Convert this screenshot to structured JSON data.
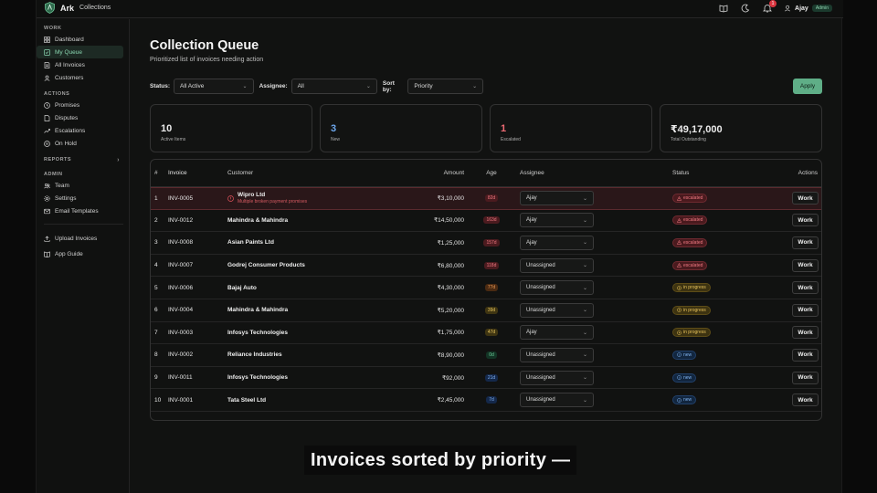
{
  "brand": {
    "name": "Ark",
    "sub": "Collections"
  },
  "topbar": {
    "notification_count": "1",
    "user_name": "Ajay",
    "user_role": "Admin"
  },
  "sidebar": {
    "work_title": "WORK",
    "work_items": [
      {
        "label": "Dashboard",
        "icon": "dashboard-icon"
      },
      {
        "label": "My Queue",
        "icon": "queue-icon",
        "active": true
      },
      {
        "label": "All Invoices",
        "icon": "invoices-icon"
      },
      {
        "label": "Customers",
        "icon": "customers-icon"
      }
    ],
    "actions_title": "ACTIONS",
    "actions_items": [
      {
        "label": "Promises",
        "icon": "clock-icon"
      },
      {
        "label": "Disputes",
        "icon": "file-icon"
      },
      {
        "label": "Escalations",
        "icon": "trend-icon"
      },
      {
        "label": "On Hold",
        "icon": "pause-icon"
      }
    ],
    "reports_title": "REPORTS",
    "admin_title": "ADMIN",
    "admin_items": [
      {
        "label": "Team",
        "icon": "team-icon"
      },
      {
        "label": "Settings",
        "icon": "gear-icon"
      },
      {
        "label": "Email Templates",
        "icon": "mail-icon"
      }
    ],
    "bottom_items": [
      {
        "label": "Upload Invoices",
        "icon": "upload-icon"
      },
      {
        "label": "App Guide",
        "icon": "book-icon"
      }
    ]
  },
  "page": {
    "title": "Collection Queue",
    "subtitle": "Prioritized list of invoices needing action"
  },
  "filters": {
    "status_label": "Status:",
    "status_value": "All Active",
    "assignee_label": "Assignee:",
    "assignee_value": "All",
    "sort_label": "Sort by:",
    "sort_value": "Priority",
    "apply_label": "Apply"
  },
  "cards": [
    {
      "value": "10",
      "label": "Active Items",
      "color": "#eaeaea"
    },
    {
      "value": "3",
      "label": "New",
      "color": "#6ea8ee"
    },
    {
      "value": "1",
      "label": "Escalated",
      "color": "#ef6b74"
    },
    {
      "value": "₹49,17,000",
      "label": "Total Outstanding",
      "color": "#eaeaea"
    }
  ],
  "table": {
    "headers": {
      "num": "#",
      "invoice": "Invoice",
      "customer": "Customer",
      "amount": "Amount",
      "age": "Age",
      "assignee": "Assignee",
      "status": "Status",
      "actions": "Actions"
    },
    "work_label": "Work",
    "rows": [
      {
        "num": "1",
        "invoice": "INV-0005",
        "customer": "Wipro Ltd",
        "note": "Multiple broken payment promises",
        "amount": "₹3,10,000",
        "age": "82d",
        "age_style": "red",
        "assignee": "Ajay",
        "status": "escalated"
      },
      {
        "num": "2",
        "invoice": "INV-0012",
        "customer": "Mahindra & Mahindra",
        "note": "",
        "amount": "₹14,50,000",
        "age": "163d",
        "age_style": "red",
        "assignee": "Ajay",
        "status": "escalated"
      },
      {
        "num": "3",
        "invoice": "INV-0008",
        "customer": "Asian Paints Ltd",
        "note": "",
        "amount": "₹1,25,000",
        "age": "157d",
        "age_style": "red",
        "assignee": "Ajay",
        "status": "escalated"
      },
      {
        "num": "4",
        "invoice": "INV-0007",
        "customer": "Godrej Consumer Products",
        "note": "",
        "amount": "₹6,80,000",
        "age": "118d",
        "age_style": "red",
        "assignee": "Unassigned",
        "status": "escalated"
      },
      {
        "num": "5",
        "invoice": "INV-0006",
        "customer": "Bajaj Auto",
        "note": "",
        "amount": "₹4,30,000",
        "age": "77d",
        "age_style": "orange",
        "assignee": "Unassigned",
        "status": "in progress"
      },
      {
        "num": "6",
        "invoice": "INV-0004",
        "customer": "Mahindra & Mahindra",
        "note": "",
        "amount": "₹5,20,000",
        "age": "39d",
        "age_style": "yellow",
        "assignee": "Unassigned",
        "status": "in progress"
      },
      {
        "num": "7",
        "invoice": "INV-0003",
        "customer": "Infosys Technologies",
        "note": "",
        "amount": "₹1,75,000",
        "age": "47d",
        "age_style": "yellow",
        "assignee": "Ajay",
        "status": "in progress"
      },
      {
        "num": "8",
        "invoice": "INV-0002",
        "customer": "Reliance Industries",
        "note": "",
        "amount": "₹8,90,000",
        "age": "0d",
        "age_style": "green",
        "assignee": "Unassigned",
        "status": "new"
      },
      {
        "num": "9",
        "invoice": "INV-0011",
        "customer": "Infosys Technologies",
        "note": "",
        "amount": "₹92,000",
        "age": "21d",
        "age_style": "blue",
        "assignee": "Unassigned",
        "status": "new"
      },
      {
        "num": "10",
        "invoice": "INV-0001",
        "customer": "Tata Steel Ltd",
        "note": "",
        "amount": "₹2,45,000",
        "age": "7d",
        "age_style": "blue",
        "assignee": "Unassigned",
        "status": "new"
      }
    ]
  },
  "caption": "Invoices sorted by priority —",
  "colors": {
    "accent": "#5fae87",
    "escalated": "#f07a82",
    "in_progress": "#e5c05a",
    "new": "#7fb2ee"
  }
}
